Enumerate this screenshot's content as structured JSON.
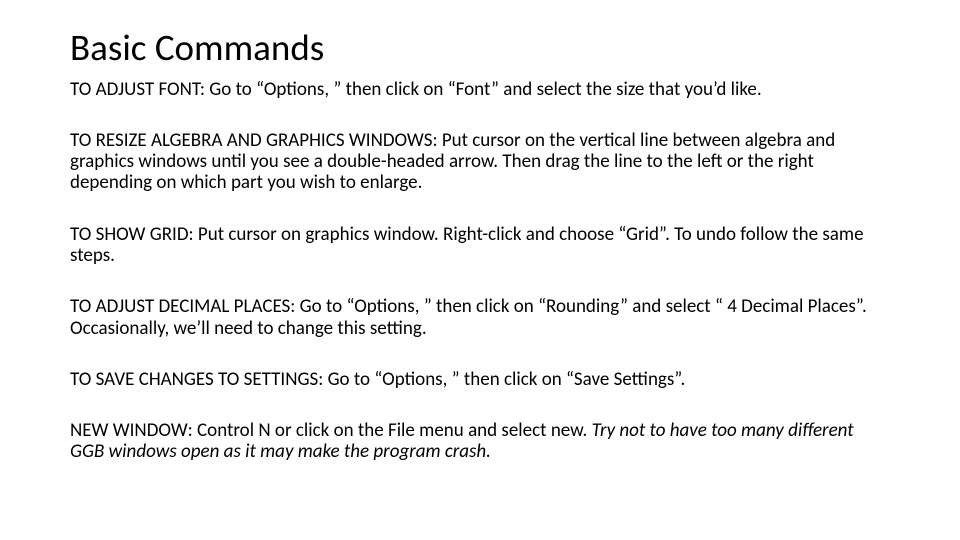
{
  "title": "Basic Commands",
  "paragraphs": {
    "p0": "TO ADJUST FONT: Go to “Options, ” then click on “Font” and select the size that you’d like.",
    "p1": "TO RESIZE ALGEBRA AND GRAPHICS WINDOWS: Put cursor on the vertical line between algebra and graphics windows until you see a double-headed arrow. Then drag the line to the left or the right depending on which part you wish to enlarge.",
    "p2": "TO SHOW GRID: Put cursor on graphics window. Right-click and choose “Grid”. To undo follow the same steps.",
    "p3": "TO ADJUST DECIMAL PLACES: Go to “Options, ” then click on “Rounding” and select “ 4 Decimal Places”. Occasionally, we’ll need to change this setting.",
    "p4": "TO SAVE CHANGES TO SETTINGS: Go to “Options, ” then click on “Save Settings”.",
    "p5a": "NEW WINDOW: Control N or click on the File menu and select new. ",
    "p5b": "Try not to have too many different GGB windows open as it may make the program crash."
  }
}
